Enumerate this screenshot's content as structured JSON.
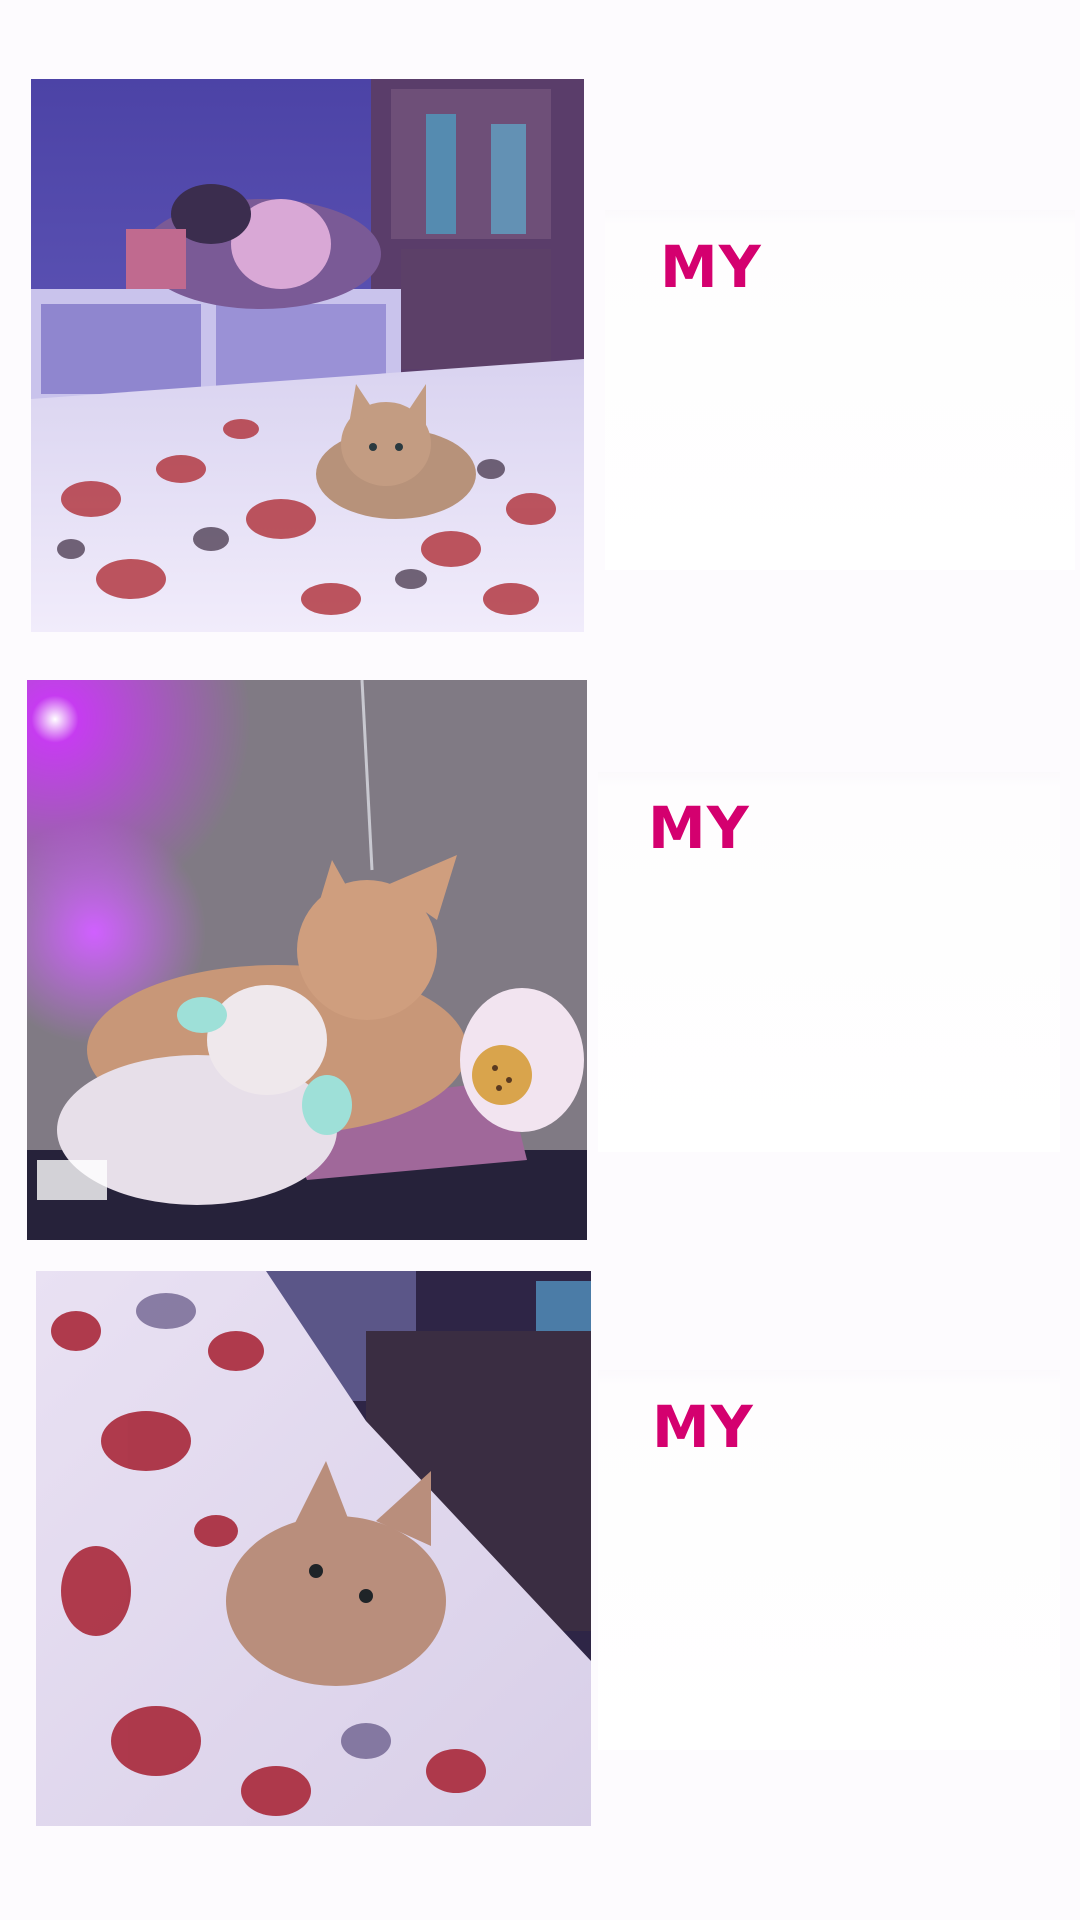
{
  "captions": [
    {
      "text": "MY"
    },
    {
      "text": "MY"
    },
    {
      "text": "MY"
    }
  ],
  "colors": {
    "caption": "#d4006f",
    "background": "#fdfbfe"
  }
}
